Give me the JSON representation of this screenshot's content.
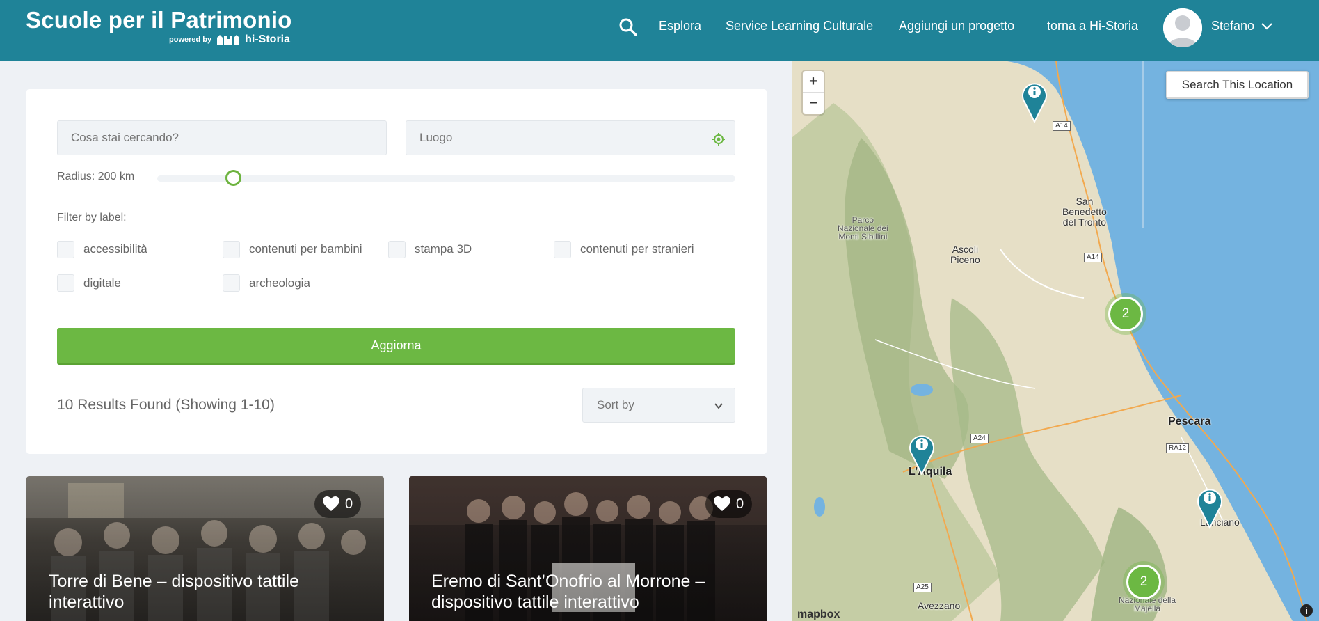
{
  "header": {
    "title": "Scuole per il Patrimonio",
    "powered_by": "powered by",
    "brand": "hi-Storia",
    "nav": [
      "Esplora",
      "Service Learning Culturale",
      "Aggiungi un progetto",
      "torna a Hi-Storia"
    ],
    "user_name": "Stefano"
  },
  "search": {
    "what_placeholder": "Cosa stai cercando?",
    "where_placeholder": "Luogo",
    "radius_label": "Radius: 200 km",
    "radius_fraction": 0.11,
    "filter_label": "Filter by label:",
    "labels": [
      "accessibilità",
      "contenuti per bambini",
      "stampa 3D",
      "contenuti per stranieri",
      "digitale",
      "archeologia"
    ],
    "update_button": "Aggiorna",
    "results_text": "10 Results Found (Showing 1-10)",
    "sort_placeholder": "Sort by"
  },
  "cards": [
    {
      "title": "Torre di Bene – dispositivo tattile interattivo",
      "likes": "0"
    },
    {
      "title": "Eremo di Sant’Onofrio al Morrone – dispositivo tattile interattivo",
      "likes": "0"
    }
  ],
  "map": {
    "search_location": "Search This Location",
    "zoom_in": "+",
    "zoom_out": "−",
    "attribution": "mapbox",
    "cities": {
      "pescara": "Pescara",
      "laquila": "L’Aquila",
      "lanciano": "Lanciano",
      "avezzano": "Avezzano",
      "ascoli": "Ascoli\nPiceno",
      "sbt": "San\nBenedetto\ndel Tronto",
      "sibillini": "Parco\nNazionale dei\nMonti Sibillini",
      "majella": "Nazionale della\nMajella"
    },
    "roads": [
      "A14",
      "A14",
      "A24",
      "RA12",
      "A25"
    ],
    "clusters": [
      "2",
      "2"
    ],
    "colors": {
      "cluster": "#6cb843",
      "pin": "#1f8398",
      "sea": "#74b3e0"
    }
  },
  "colors": {
    "header": "#1f8398",
    "accent": "#6cb843"
  }
}
